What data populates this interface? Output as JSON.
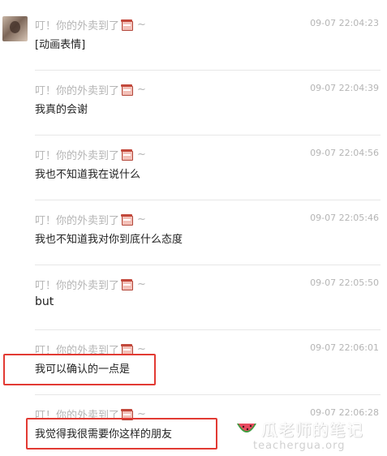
{
  "sender_name": "叮！你的外卖到了",
  "sender_suffix": "~",
  "messages": [
    {
      "time": "09-07 22:04:23",
      "text": "[动画表情]"
    },
    {
      "time": "09-07 22:04:39",
      "text": "我真的会谢"
    },
    {
      "time": "09-07 22:04:56",
      "text": "我也不知道我在说什么"
    },
    {
      "time": "09-07 22:05:46",
      "text": "我也不知道我对你到底什么态度"
    },
    {
      "time": "09-07 22:05:50",
      "text": "but"
    },
    {
      "time": "09-07 22:06:01",
      "text": "我可以确认的一点是"
    },
    {
      "time": "09-07 22:06:28",
      "text": "我觉得我很需要你这样的朋友"
    }
  ],
  "watermark": {
    "title": "瓜老师的笔记",
    "url": "teachergua.org"
  },
  "colors": {
    "highlight": "#e23a33",
    "meta_text": "#b5b5b5",
    "body_text": "#222222"
  }
}
